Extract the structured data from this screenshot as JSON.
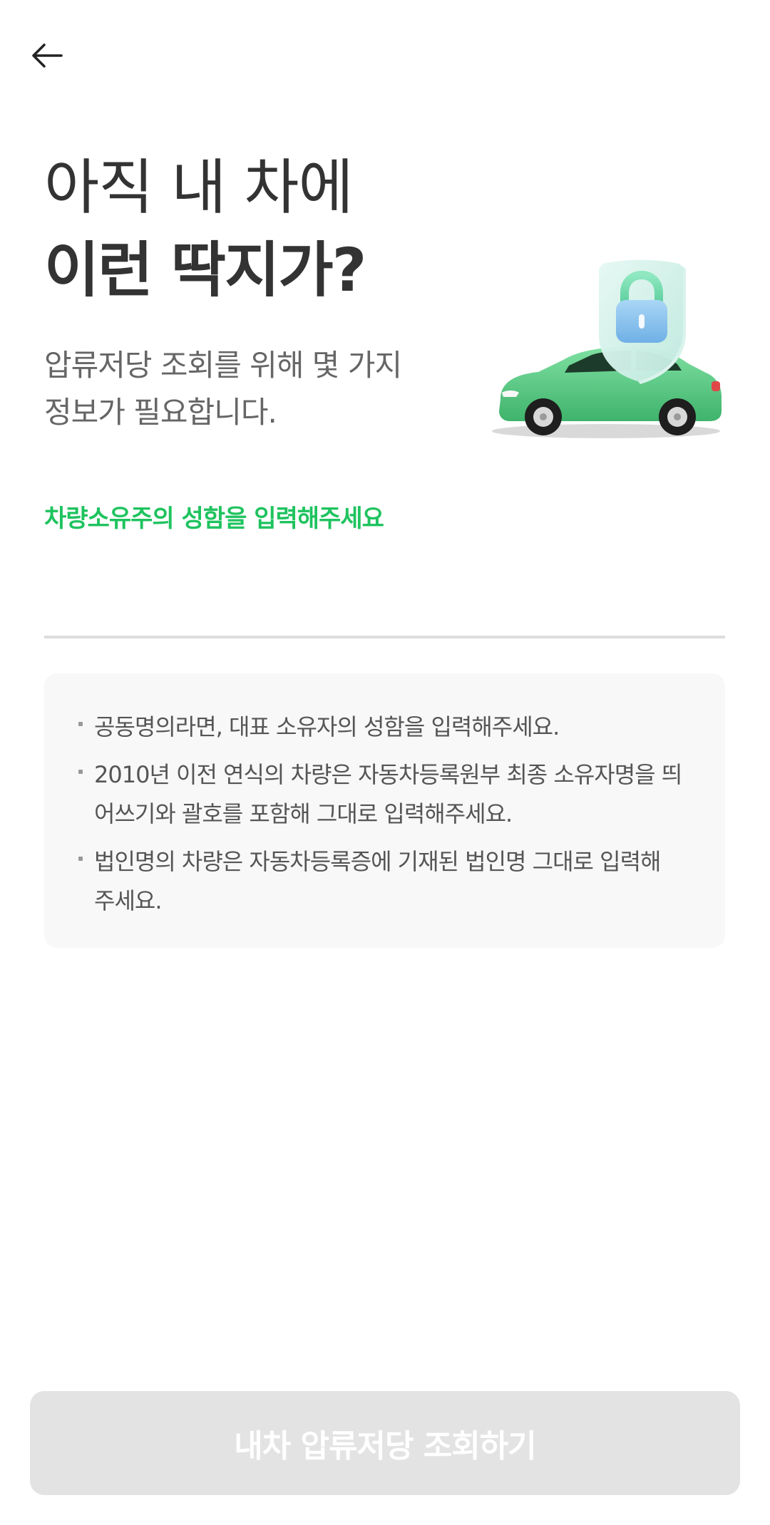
{
  "header": {
    "back_icon": "arrow-left-icon"
  },
  "headline": {
    "line1": "아직 내 차에",
    "line2": "이런 딱지가?"
  },
  "subtitle": {
    "line1": "압류저당 조회를 위해 몇 가지",
    "line2": "정보가 필요합니다."
  },
  "illustration": {
    "icon": "car-with-lock-shield-icon",
    "car_color": "#5fd08a",
    "shield_color": "#cfeee6",
    "lock_color": "#8ec5ee"
  },
  "form": {
    "name_label": "차량소유주의 성함을 입력해주세요",
    "name_value": "",
    "accent_color": "#1fc35f"
  },
  "notices": [
    {
      "lines": [
        "공동명의라면, 대표 소유자의 성함을 입력해주세요."
      ]
    },
    {
      "lines": [
        "2010년 이전 연식의 차량은 자동차등록원부 최종 소유자명을 띄",
        "어쓰기와 괄호를 포함해 그대로 입력해주세요."
      ]
    },
    {
      "lines": [
        "법인명의 차량은 자동차등록증에 기재된 법인명 그대로 입력해",
        "주세요."
      ]
    }
  ],
  "submit": {
    "label": "내차 압류저당 조회하기",
    "state": "disabled",
    "background": "#e3e3e3"
  }
}
